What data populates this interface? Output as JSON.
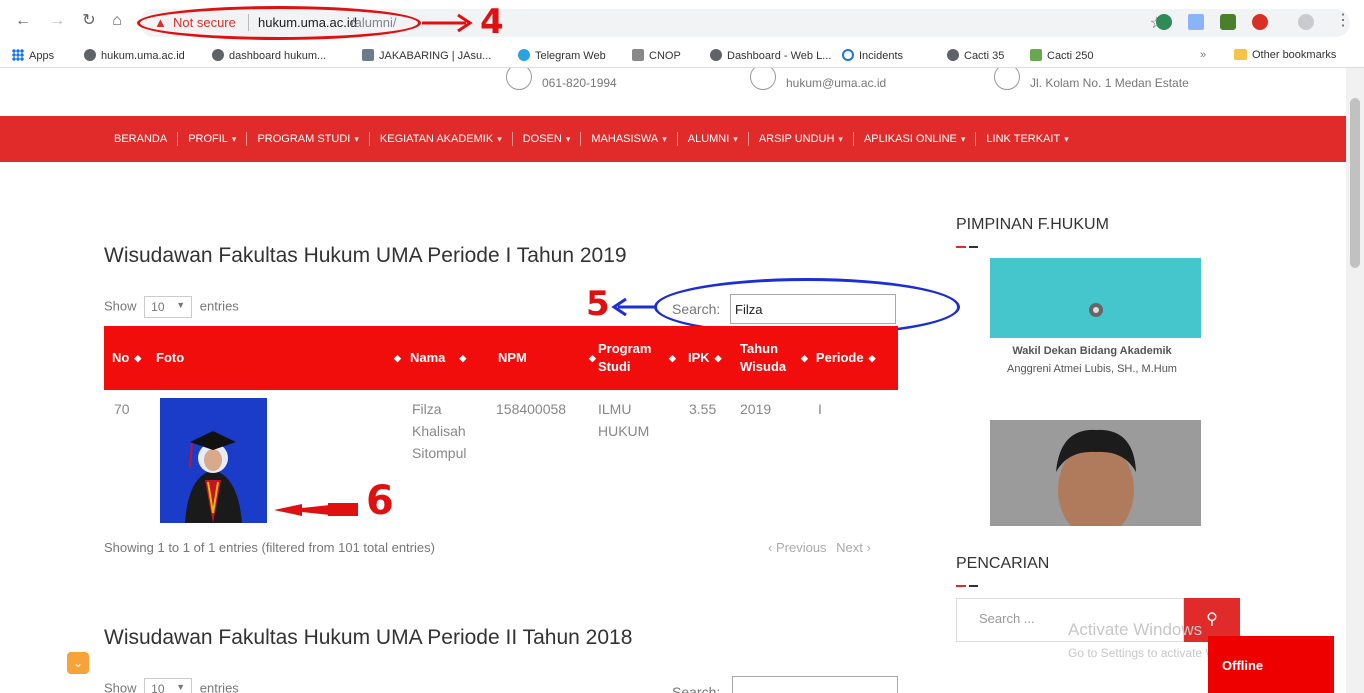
{
  "browser": {
    "security_label": "Not secure",
    "url_host": "hukum.uma.ac.id",
    "url_path": "/alumni/",
    "bookmarks": [
      "Apps",
      "hukum.uma.ac.id",
      "dashboard hukum...",
      "JAKABARING | JAsu...",
      "Telegram Web",
      "CNOP",
      "Dashboard - Web L...",
      "Incidents",
      "Cacti 35",
      "Cacti 250"
    ],
    "overflow": "»",
    "other_bookmarks": "Other bookmarks"
  },
  "annotations": {
    "n4": "4",
    "n5": "5",
    "n6": "6"
  },
  "contact": {
    "phone": "061-820-1994",
    "email": "hukum@uma.ac.id",
    "address": "Jl. Kolam No. 1 Medan Estate"
  },
  "menu": [
    {
      "label": "BERANDA"
    },
    {
      "label": "PROFIL",
      "caret": "▾"
    },
    {
      "label": "PROGRAM STUDI",
      "caret": "▾"
    },
    {
      "label": "KEGIATAN AKADEMIK",
      "caret": "▾"
    },
    {
      "label": "DOSEN",
      "caret": "▾"
    },
    {
      "label": "MAHASISWA",
      "caret": "▾"
    },
    {
      "label": "ALUMNI",
      "caret": "▾"
    },
    {
      "label": "ARSIP UNDUH",
      "caret": "▾"
    },
    {
      "label": "APLIKASI ONLINE",
      "caret": "▾"
    },
    {
      "label": "LINK TERKAIT",
      "caret": "▾"
    }
  ],
  "section1": {
    "title": "Wisudawan Fakultas Hukum UMA Periode I Tahun 2019",
    "show": "Show",
    "entries_value": "10",
    "entries": "entries",
    "search_label": "Search:",
    "search_value": "Filza",
    "columns": {
      "no": "No",
      "foto": "Foto",
      "nama": "Nama",
      "npm": "NPM",
      "program1": "Program",
      "program2": "Studi",
      "ipk": "IPK",
      "tahun1": "Tahun",
      "tahun2": "Wisuda",
      "periode": "Periode"
    },
    "row": {
      "no": "70",
      "nama1": "Filza",
      "nama2": "Khalisah",
      "nama3": "Sitompul",
      "npm": "158400058",
      "program1": "ILMU",
      "program2": "HUKUM",
      "ipk": "3.55",
      "tahun": "2019",
      "periode": "I"
    },
    "info": "Showing 1 to 1 of 1 entries (filtered from 101 total entries)",
    "previous": "Previous",
    "next": "Next"
  },
  "section2": {
    "title": "Wisudawan Fakultas Hukum UMA Periode II Tahun 2018",
    "show": "Show",
    "entries_value": "10",
    "entries": "entries",
    "search_label": "Search:"
  },
  "sidebar": {
    "pimpinan_title": "PIMPINAN F.HUKUM",
    "caption1": "Wakil Dekan Bidang Akademik",
    "caption2": "Anggreni Atmei Lubis, SH., M.Hum",
    "pencarian_title": "PENCARIAN",
    "search_placeholder": "Search ..."
  },
  "overlay": {
    "activate1": "Activate Windows",
    "activate2": "Go to Settings to activate Windows.",
    "offline": "Offline"
  },
  "colors": {
    "menu_red": "#e12a2a",
    "table_header_red": "#f20d0d",
    "annotation_red": "#e01010",
    "annotation_blue": "#1c2fd6"
  }
}
